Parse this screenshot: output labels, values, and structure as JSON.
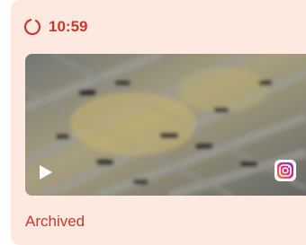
{
  "timer": {
    "time": "10:59",
    "icon": "loading-spinner-icon"
  },
  "media": {
    "thumbnail": "aerial-view-thumbnail",
    "play_icon": "play-icon",
    "platform_icon": "instagram-icon"
  },
  "status": {
    "label": "Archived"
  },
  "colors": {
    "card_background": "#fde9df",
    "accent_red": "#c8382b"
  }
}
